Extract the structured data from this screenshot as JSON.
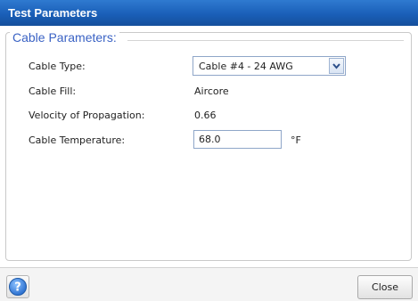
{
  "window": {
    "title": "Test Parameters"
  },
  "group": {
    "legend": "Cable Parameters:",
    "cable_type": {
      "label": "Cable Type:",
      "selected": "Cable #4 - 24 AWG"
    },
    "cable_fill": {
      "label": "Cable Fill:",
      "value": "Aircore"
    },
    "velocity": {
      "label": "Velocity of Propagation:",
      "value": "0.66"
    },
    "temperature": {
      "label": "Cable Temperature:",
      "value": "68.0",
      "unit": "°F"
    }
  },
  "footer": {
    "help_icon": "help-icon",
    "close_label": "Close"
  },
  "colors": {
    "titlebar": "#1a5fb8",
    "legend": "#3a62c4",
    "help": "#3c7fd6"
  }
}
